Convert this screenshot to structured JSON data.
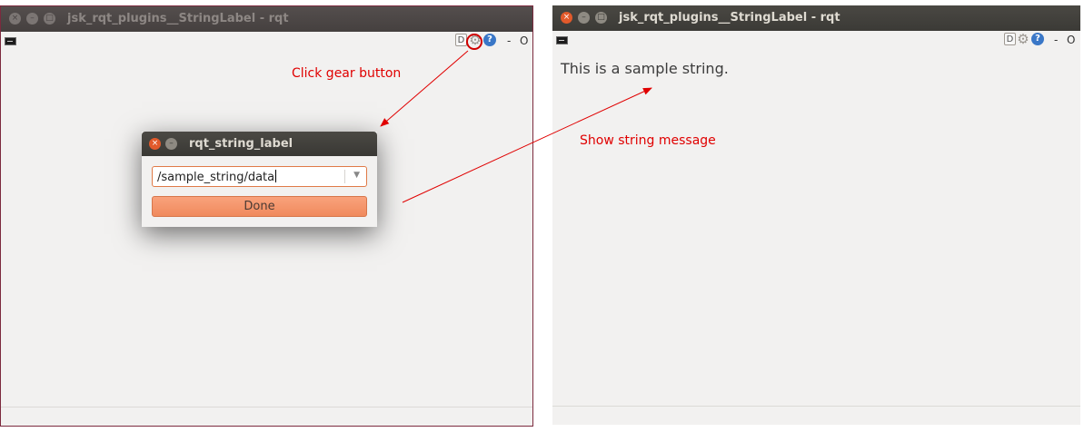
{
  "left_window": {
    "title": "jsk_rqt_plugins__StringLabel - rqt",
    "controls": {
      "d_label": "D",
      "help_label": "?",
      "minimize_label": "-",
      "close_label": "O"
    }
  },
  "dialog": {
    "title": "rqt_string_label",
    "topic_value": "/sample_string/data",
    "done_label": "Done"
  },
  "right_window": {
    "title": "jsk_rqt_plugins__StringLabel - rqt",
    "controls": {
      "d_label": "D",
      "help_label": "?",
      "minimize_label": "-",
      "close_label": "O"
    },
    "label_text": "This is a sample string."
  },
  "annotations": {
    "gear_hint": "Click gear button",
    "result_hint": "Show string message",
    "color": "#e00000"
  },
  "icons": [
    "close-icon",
    "minimize-icon",
    "maximize-icon",
    "terminal-icon",
    "gear-icon",
    "help-icon"
  ]
}
